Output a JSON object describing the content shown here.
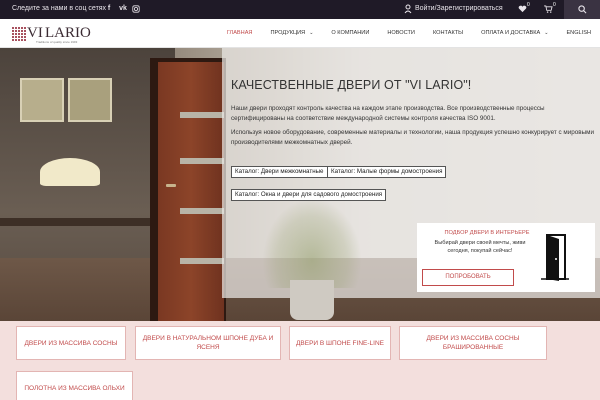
{
  "topbar": {
    "social_text": "Следите за нами в соц сетях",
    "social_icons": [
      "facebook-icon",
      "vk-icon",
      "instagram-icon"
    ],
    "facebook_glyph": "f",
    "vk_glyph": "vk",
    "login_text": "Войти/Зарегистрироваться",
    "wishlist_count": "0",
    "cart_count": "0",
    "colors": {
      "background": "#1f1a27",
      "search_bg": "#3a3342"
    }
  },
  "header": {
    "logo_text": "LARIO",
    "logo_tagline": "Traditions of quality since 1993",
    "nav": [
      {
        "label": "ГЛАВНАЯ",
        "active": true,
        "dropdown": false
      },
      {
        "label": "ПРОДУКЦИЯ",
        "active": false,
        "dropdown": true
      },
      {
        "label": "О КОМПАНИИ",
        "active": false,
        "dropdown": false
      },
      {
        "label": "НОВОСТИ",
        "active": false,
        "dropdown": false
      },
      {
        "label": "КОНТАКТЫ",
        "active": false,
        "dropdown": false
      },
      {
        "label": "ОПЛАТА И ДОСТАВКА",
        "active": false,
        "dropdown": true
      },
      {
        "label": "ENGLISH",
        "active": false,
        "dropdown": false
      }
    ],
    "accent_color": "#c14b4b"
  },
  "hero": {
    "title": "КАЧЕСТВЕННЫЕ ДВЕРИ ОТ \"VI LARIO\"!",
    "paragraph1": "Наши двери проходят контроль качества на каждом этапе производства. Все производственные процессы сертифицированы на соответствие международной системы контроля качества ISO 9001.",
    "paragraph2": "Используя новое оборудование, современные материалы и технологии, наша продукция успешно конкурирует с мировыми производителями межкомнатных дверей.",
    "catalog_buttons": [
      "Каталог: Двери межкомнатные",
      "Каталог: Малые формы домостроения",
      "Каталог: Окна и двери для садового домостроения"
    ]
  },
  "promo": {
    "title": "ПОДБОР ДВЕРИ В ИНТЕРЬЕРЕ",
    "text": "Выбирай двери своей мечты, живи сегодня, покупай сейчас!",
    "button": "ПОПРОБОВАТЬ"
  },
  "categories": [
    "ДВЕРИ ИЗ МАССИВА СОСНЫ",
    "ДВЕРИ В НАТУРАЛЬНОМ ШПОНЕ ДУБА И ЯСЕНЯ",
    "ДВЕРИ В ШПОНЕ FINE-LINE",
    "ДВЕРИ ИЗ МАССИВА СОСНЫ БРАШИРОВАННЫЕ",
    "ПОЛОТНА ИЗ МАССИВА ОЛЬХИ"
  ]
}
